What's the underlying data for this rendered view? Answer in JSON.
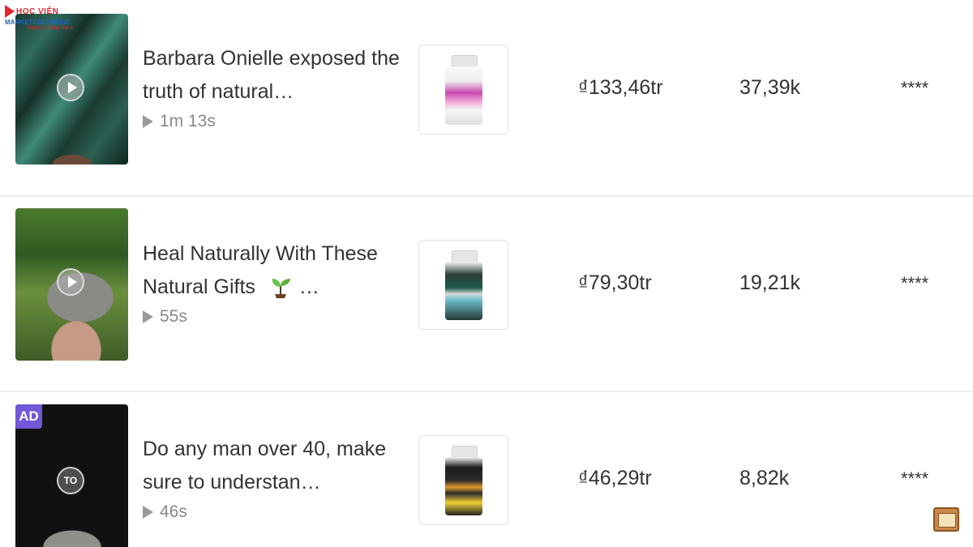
{
  "logo": {
    "brand": "HỌC VIỆN",
    "line2": "MARKETING ONLINE",
    "line3": "Nghề Cá Công Nghệ"
  },
  "rows": [
    {
      "title": "Barbara Onielle exposed the truth of natural…",
      "duration": "1m 13s",
      "price": "₫133,46tr",
      "count": "37,39k",
      "rating": "****",
      "ad": false
    },
    {
      "title": "Heal Naturally With These Natural Gifts",
      "title_suffix": "…",
      "duration": "55s",
      "price": "₫79,30tr",
      "count": "19,21k",
      "rating": "****",
      "ad": false
    },
    {
      "title": "Do any man over 40, make sure to understan…",
      "duration": "46s",
      "price": "₫46,29tr",
      "count": "8,82k",
      "rating": "****",
      "ad": true,
      "ad_label": "AD",
      "platform_icon_text": "TO"
    }
  ],
  "icons": {
    "play": "play-icon",
    "duration": "play-triangle-icon",
    "sprout": "seedling-icon",
    "corner": "media-icon"
  }
}
